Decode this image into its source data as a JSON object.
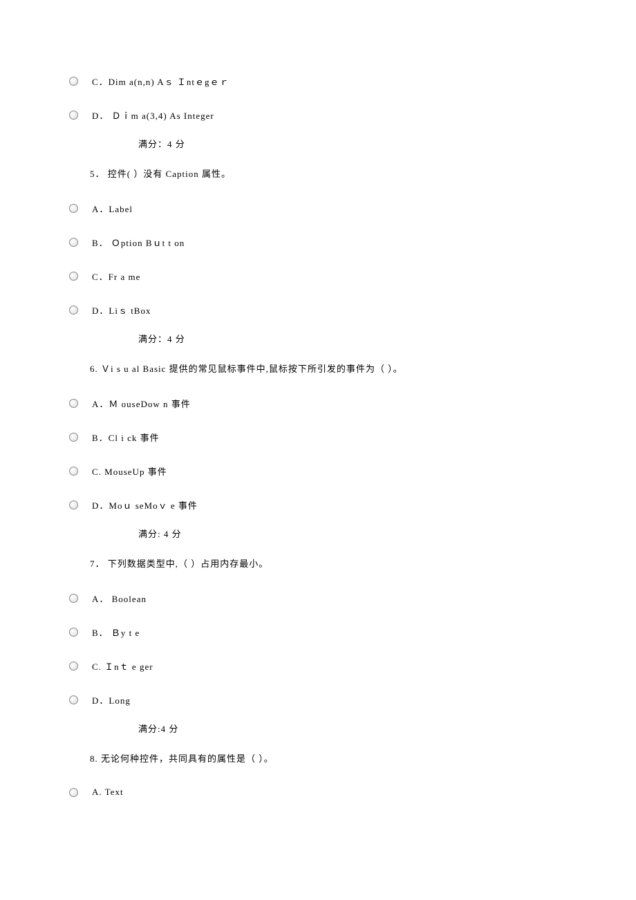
{
  "q_prev": {
    "opt_c": "C．Dim a(n,n) Aｓ  Ｉntｅgｅｒ",
    "opt_d": "D． Ｄｉm a(3,4)  As Integer",
    "score": "满分：4    分"
  },
  "q5": {
    "text": "5．    控件(     ）没有 Caption 属性。",
    "opt_a": "A．Label",
    "opt_b": "B．  Ｏption Bｕt t on",
    "opt_c": "C．Fr a me",
    "opt_d": "D．Liｓ tBox",
    "score": "满分：4    分"
  },
  "q6": {
    "text": "6.      Ｖi s u al Basic 提供的常见鼠标事件中,鼠标按下所引发的事件为（  ）。",
    "opt_a": "A．Ｍ ouseDow n 事件",
    "opt_b": "B．Cl i ck 事件",
    "opt_c": "C.   MouseUp 事件",
    "opt_d": "D．Moｕ seMoｖ e 事件",
    "score": "满分: 4    分"
  },
  "q7": {
    "text": "7．   下列数据类型中,（  ）占用内存最小。",
    "opt_a": "A．  Boolean",
    "opt_b": "B．  Ｂy t e",
    "opt_c": "C. Ｉnｔ e ger",
    "opt_d": "D．Long",
    "score": "满分:4    分"
  },
  "q8": {
    "text": "8.      无论何种控件，共同具有的属性是（  ）。",
    "opt_a": "A.   Text"
  }
}
